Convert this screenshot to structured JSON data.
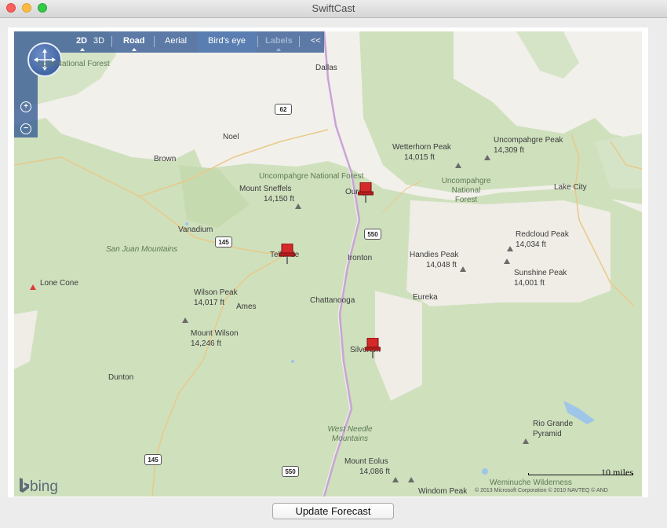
{
  "window": {
    "title": "SwiftCast"
  },
  "map_controls": {
    "view_2d": "2D",
    "view_3d": "3D",
    "road": "Road",
    "aerial": "Aerial",
    "birds_eye": "Bird's eye",
    "labels": "Labels",
    "collapse": "<<"
  },
  "map": {
    "places": {
      "dallas": "Dallas",
      "noel": "Noel",
      "brown": "Brown",
      "vanadium": "Vanadium",
      "telluride": "Telluride",
      "ouray": "Ouray",
      "ironton": "Ironton",
      "eureka": "Eureka",
      "chattanooga": "Chattanooga",
      "ames": "Ames",
      "dunton": "Dunton",
      "silverton": "Silverton",
      "lake_city": "Lake City"
    },
    "forests": {
      "unc_nf_top": "hgre National Forest",
      "unc_nf_mid": "Uncompahgre National Forest",
      "unc_nf_right_1": "Uncompahgre",
      "unc_nf_right_2": "National",
      "unc_nf_right_3": "Forest"
    },
    "ranges": {
      "san_juan": "San Juan Mountains",
      "west_needle_1": "West Needle",
      "west_needle_2": "Mountains"
    },
    "peaks": {
      "sneffels_name": "Mount Sneffels",
      "sneffels_elev": "14,150 ft",
      "wetterhorn_name": "Wetterhorn Peak",
      "wetterhorn_elev": "14,015 ft",
      "uncompahgre_name": "Uncompahgre Peak",
      "uncompahgre_elev": "14,309 ft",
      "redcloud_name": "Redcloud Peak",
      "redcloud_elev": "14,034 ft",
      "handies_name": "Handies Peak",
      "handies_elev": "14,048 ft",
      "sunshine_name": "Sunshine Peak",
      "sunshine_elev": "14,001 ft",
      "wilson_peak_name": "Wilson Peak",
      "wilson_peak_elev": "14,017 ft",
      "mount_wilson_name": "Mount Wilson",
      "mount_wilson_elev": "14,246 ft",
      "lone_cone_name": "Lone Cone",
      "rio_grande_1": "Rio Grande",
      "rio_grande_2": "Pyramid",
      "eolus_name": "Mount Eolus",
      "eolus_elev": "14,086 ft",
      "windom_name": "Windom Peak",
      "weminuche": "Weminuche Wilderness"
    },
    "highways": {
      "h62": "62",
      "h145a": "145",
      "h550a": "550",
      "h145b": "145",
      "h550b": "550"
    },
    "scale": "10 miles",
    "copyright": "© 2013 Microsoft Corporation   © 2010 NAVTEQ   © AND",
    "logo": "bing"
  },
  "actions": {
    "update_forecast": "Update Forecast"
  },
  "colors": {
    "forest": "#cfe0bd",
    "land": "#f2f0ea",
    "road": "#e9c98a",
    "highway": "#c8a4d4",
    "pin": "#d42a2a"
  }
}
